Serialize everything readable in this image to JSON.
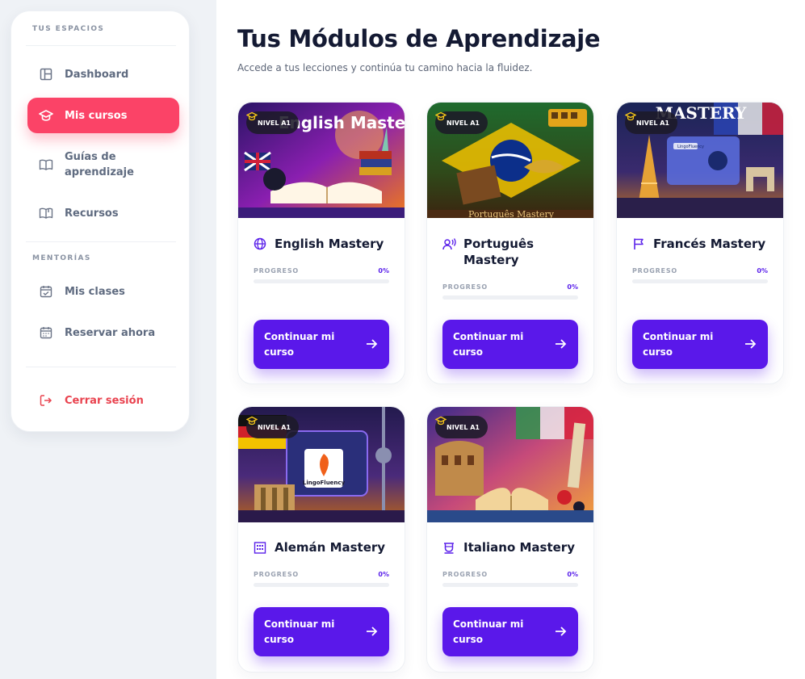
{
  "sidebar": {
    "section_spaces": "TUS ESPACIOS",
    "section_mentoring": "MENTORÍAS",
    "items": [
      {
        "label": "Dashboard",
        "icon": "layout-icon"
      },
      {
        "label": "Mis cursos",
        "icon": "graduation-cap-icon",
        "active": true
      },
      {
        "label": "Guías de aprendizaje",
        "icon": "open-book-icon"
      },
      {
        "label": "Recursos",
        "icon": "book-icon"
      },
      {
        "label": "Mis clases",
        "icon": "calendar-check-icon"
      },
      {
        "label": "Reservar ahora",
        "icon": "calendar-icon"
      },
      {
        "label": "Cerrar sesión",
        "icon": "logout-icon"
      }
    ]
  },
  "main": {
    "title": "Tus Módulos de Aprendizaje",
    "subtitle": "Accede a tus lecciones y continúa tu camino hacia la fluidez."
  },
  "courses": [
    {
      "title": "English Mastery",
      "level": "NIVEL A1",
      "progress_label": "PROGRESO",
      "progress_value": "0%",
      "progress": 0,
      "button": "Continuar mi curso",
      "icon": "globe-icon"
    },
    {
      "title": "Português Mastery",
      "level": "NIVEL A1",
      "progress_label": "PROGRESO",
      "progress_value": "0%",
      "progress": 0,
      "button": "Continuar mi curso",
      "icon": "speaking-person-icon"
    },
    {
      "title": "Francés Mastery",
      "level": "NIVEL A1",
      "progress_label": "PROGRESO",
      "progress_value": "0%",
      "progress": 0,
      "button": "Continuar mi curso",
      "icon": "flag-icon"
    },
    {
      "title": "Alemán Mastery",
      "level": "NIVEL A1",
      "progress_label": "PROGRESO",
      "progress_value": "0%",
      "progress": 0,
      "button": "Continuar mi curso",
      "icon": "building-icon"
    },
    {
      "title": "Italiano Mastery",
      "level": "NIVEL A1",
      "progress_label": "PROGRESO",
      "progress_value": "0%",
      "progress": 0,
      "button": "Continuar mi curso",
      "icon": "coffee-cup-icon"
    }
  ],
  "image_text": {
    "english": "English Mastery",
    "portugues": "Português Mastery",
    "frances": "MASTERY",
    "frances_app": "LingoFluency",
    "aleman_app": "LingoFluency"
  },
  "colors": {
    "accent": "#5a18ea",
    "active_nav": "#fb4367",
    "logout": "#e9434f",
    "title": "#141a33"
  }
}
